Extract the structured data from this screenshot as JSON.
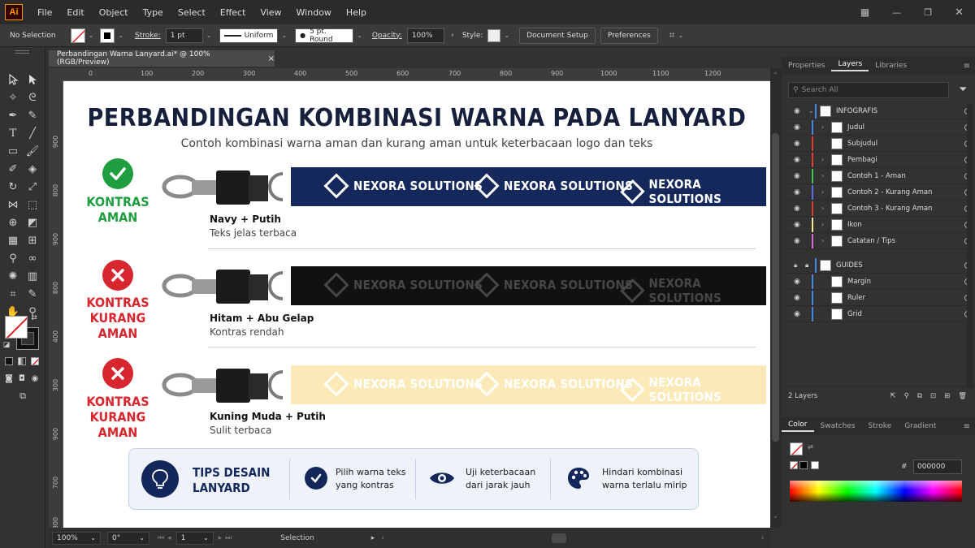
{
  "app": {
    "logo": "Ai",
    "menu": [
      "File",
      "Edit",
      "Object",
      "Type",
      "Select",
      "Effect",
      "View",
      "Window",
      "Help"
    ]
  },
  "control_bar": {
    "selection": "No Selection",
    "stroke_label": "Stroke:",
    "stroke_value": "1 pt",
    "profile": "Uniform",
    "brush": "5 pt. Round",
    "opacity_label": "Opacity:",
    "opacity_value": "100%",
    "style_label": "Style:",
    "doc_setup": "Document Setup",
    "preferences": "Preferences"
  },
  "document_tab": {
    "title": "Perbandingan Warna Lanyard.ai* @ 100% (RGB/Preview)",
    "close": "×"
  },
  "ruler_h": [
    "0",
    "100",
    "200",
    "300",
    "400",
    "500",
    "600",
    "700",
    "800",
    "900",
    "1000",
    "1100",
    "1200"
  ],
  "ruler_v": [
    "900",
    "800",
    "900",
    "800",
    "400",
    "300",
    "900",
    "700",
    "800"
  ],
  "artboard": {
    "title": "PERBANDINGAN KOMBINASI WARNA PADA LANYARD",
    "subtitle": "Contoh kombinasi warna aman dan kurang aman untuk keterbacaan logo dan teks",
    "brand": "NEXORA SOLUTIONS",
    "examples": [
      {
        "status_line1": "KONTRAS",
        "status_line2": "AMAN",
        "status_color": "#1e9e3f",
        "icon": "check-icon",
        "name": "Navy + Putih",
        "desc": "Teks jelas terbaca",
        "strap_color": "#14285c",
        "text_color": "#ffffff"
      },
      {
        "status_line1": "KONTRAS",
        "status_line2": "KURANG AMAN",
        "status_color": "#d8262e",
        "icon": "x-icon",
        "name": "Hitam + Abu Gelap",
        "desc": "Kontras rendah",
        "strap_color": "#111111",
        "text_color": "#474747"
      },
      {
        "status_line1": "KONTRAS",
        "status_line2": "KURANG AMAN",
        "status_color": "#d8262e",
        "icon": "x-icon",
        "name": "Kuning Muda + Putih",
        "desc": "Sulit terbaca",
        "strap_color": "#fbeab8",
        "text_color": "#ffffff"
      }
    ],
    "tips": {
      "heading_line1": "TIPS DESAIN",
      "heading_line2": "LANYARD",
      "items": [
        {
          "line1": "Pilih warna teks",
          "line2": "yang kontras"
        },
        {
          "line1": "Uji keterbacaan",
          "line2": "dari jarak jauh"
        },
        {
          "line1": "Hindari kombinasi",
          "line2": "warna terlalu mirip"
        }
      ]
    }
  },
  "status_bar": {
    "zoom": "100%",
    "rotation": "0°",
    "artboard": "1",
    "tool": "Selection"
  },
  "panel": {
    "tabs": [
      "Properties",
      "Layers",
      "Libraries"
    ],
    "search_placeholder": "Search All",
    "layers": [
      {
        "name": "INFOGRAFIS",
        "color": "#4a86e8",
        "top": true
      },
      {
        "name": "Judul",
        "color": "#4a86e8"
      },
      {
        "name": "Subjudul",
        "color": "#e53935"
      },
      {
        "name": "Pembagi",
        "color": "#e53935"
      },
      {
        "name": "Contoh 1 - Aman",
        "color": "#43c050"
      },
      {
        "name": "Contoh 2 - Kurang Aman",
        "color": "#5b6ef0"
      },
      {
        "name": "Contoh 3 - Kurang Aman",
        "color": "#e53935"
      },
      {
        "name": "Ikon",
        "color": "#f2e79a"
      },
      {
        "name": "Catatan / Tips",
        "color": "#d36bd8"
      },
      {
        "name": "GUIDES",
        "color": "#4a86e8",
        "top": true
      },
      {
        "name": "Margin",
        "color": "#4a86e8"
      },
      {
        "name": "Ruler",
        "color": "#4a86e8"
      },
      {
        "name": "Grid",
        "color": "#4a86e8"
      }
    ],
    "layers_count": "2 Layers",
    "color_tabs": [
      "Color",
      "Swatches",
      "Stroke",
      "Gradient"
    ],
    "hex_label": "#",
    "hex_value": "000000"
  }
}
